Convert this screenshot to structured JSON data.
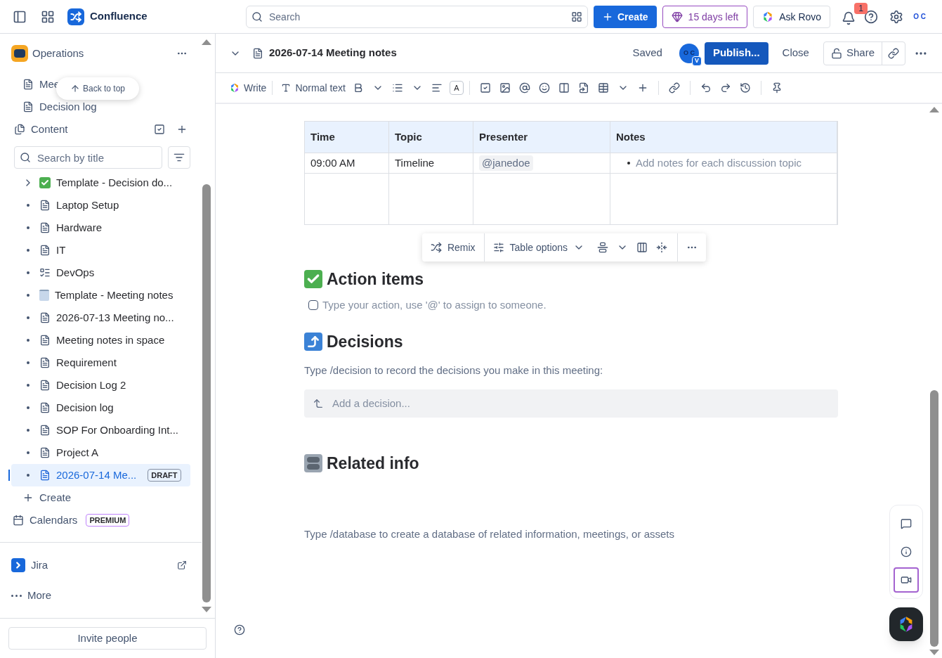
{
  "topbar": {
    "app_name": "Confluence",
    "search_placeholder": "Search",
    "create": "Create",
    "trial": "15 days left",
    "ask": "Ask Rovo",
    "notification_count": "1",
    "avatar_text": "O C"
  },
  "sidebar": {
    "space": "Operations",
    "back_to_top": "Back to top",
    "pinned": [
      {
        "label": "Mee"
      },
      {
        "label": "Decision log"
      }
    ],
    "content_label": "Content",
    "search_placeholder": "Search by title",
    "tree": [
      {
        "label": "Template - Decision do...",
        "kind": "check",
        "expandable": true,
        "selected": false
      },
      {
        "label": "Laptop Setup",
        "kind": "page",
        "expandable": false,
        "selected": false
      },
      {
        "label": "Hardware",
        "kind": "page",
        "expandable": false,
        "selected": false
      },
      {
        "label": "IT",
        "kind": "page",
        "expandable": false,
        "selected": false
      },
      {
        "label": "DevOps",
        "kind": "live",
        "expandable": false,
        "selected": false
      },
      {
        "label": "Template - Meeting notes",
        "kind": "notepad",
        "expandable": false,
        "selected": false
      },
      {
        "label": "2026-07-13 Meeting no...",
        "kind": "page",
        "expandable": false,
        "selected": false
      },
      {
        "label": "Meeting notes in space",
        "kind": "page",
        "expandable": false,
        "selected": false
      },
      {
        "label": "Requirement",
        "kind": "page",
        "expandable": false,
        "selected": false
      },
      {
        "label": "Decision Log 2",
        "kind": "page",
        "expandable": false,
        "selected": false
      },
      {
        "label": "Decision log",
        "kind": "page",
        "expandable": false,
        "selected": false
      },
      {
        "label": "SOP For Onboarding Int...",
        "kind": "page",
        "expandable": false,
        "selected": false
      },
      {
        "label": "Project A",
        "kind": "page",
        "expandable": false,
        "selected": false
      },
      {
        "label": "2026-07-14 Me...",
        "kind": "page",
        "expandable": false,
        "selected": true,
        "badge": "DRAFT"
      }
    ],
    "create": "Create",
    "calendars": "Calendars",
    "calendars_badge": "PREMIUM",
    "jira": "Jira",
    "more": "More",
    "invite": "Invite people"
  },
  "page": {
    "title": "2026-07-14 Meeting notes",
    "status": "Saved",
    "avatar_text": "O C",
    "avatar_badge": "V",
    "publish": "Publish...",
    "close": "Close",
    "share": "Share"
  },
  "toolbar": {
    "write": "Write",
    "text_style": "Normal text",
    "text_color": "A"
  },
  "table": {
    "columns": [
      "Time",
      "Topic",
      "Presenter",
      "Notes"
    ],
    "rows": [
      [
        "09:00 AM",
        "Timeline",
        "@janedoe",
        "Add notes for each discussion topic"
      ],
      [
        "",
        "",
        "",
        ""
      ]
    ]
  },
  "table_toolbar": {
    "remix": "Remix",
    "options": "Table options"
  },
  "sections": [
    {
      "kind": "tasks",
      "heading": "Action items",
      "task": {
        "text": "Type your action, use '@' to assign to someone.",
        "checked": false
      }
    },
    {
      "kind": "decisions",
      "heading": "Decisions",
      "text": "Type /decision to record the decisions you make in this meeting:",
      "decision_placeholder": "Add a decision..."
    },
    {
      "kind": "info",
      "heading": "Related info",
      "text": "Type /database to create a database of related information, meetings, or assets"
    }
  ]
}
